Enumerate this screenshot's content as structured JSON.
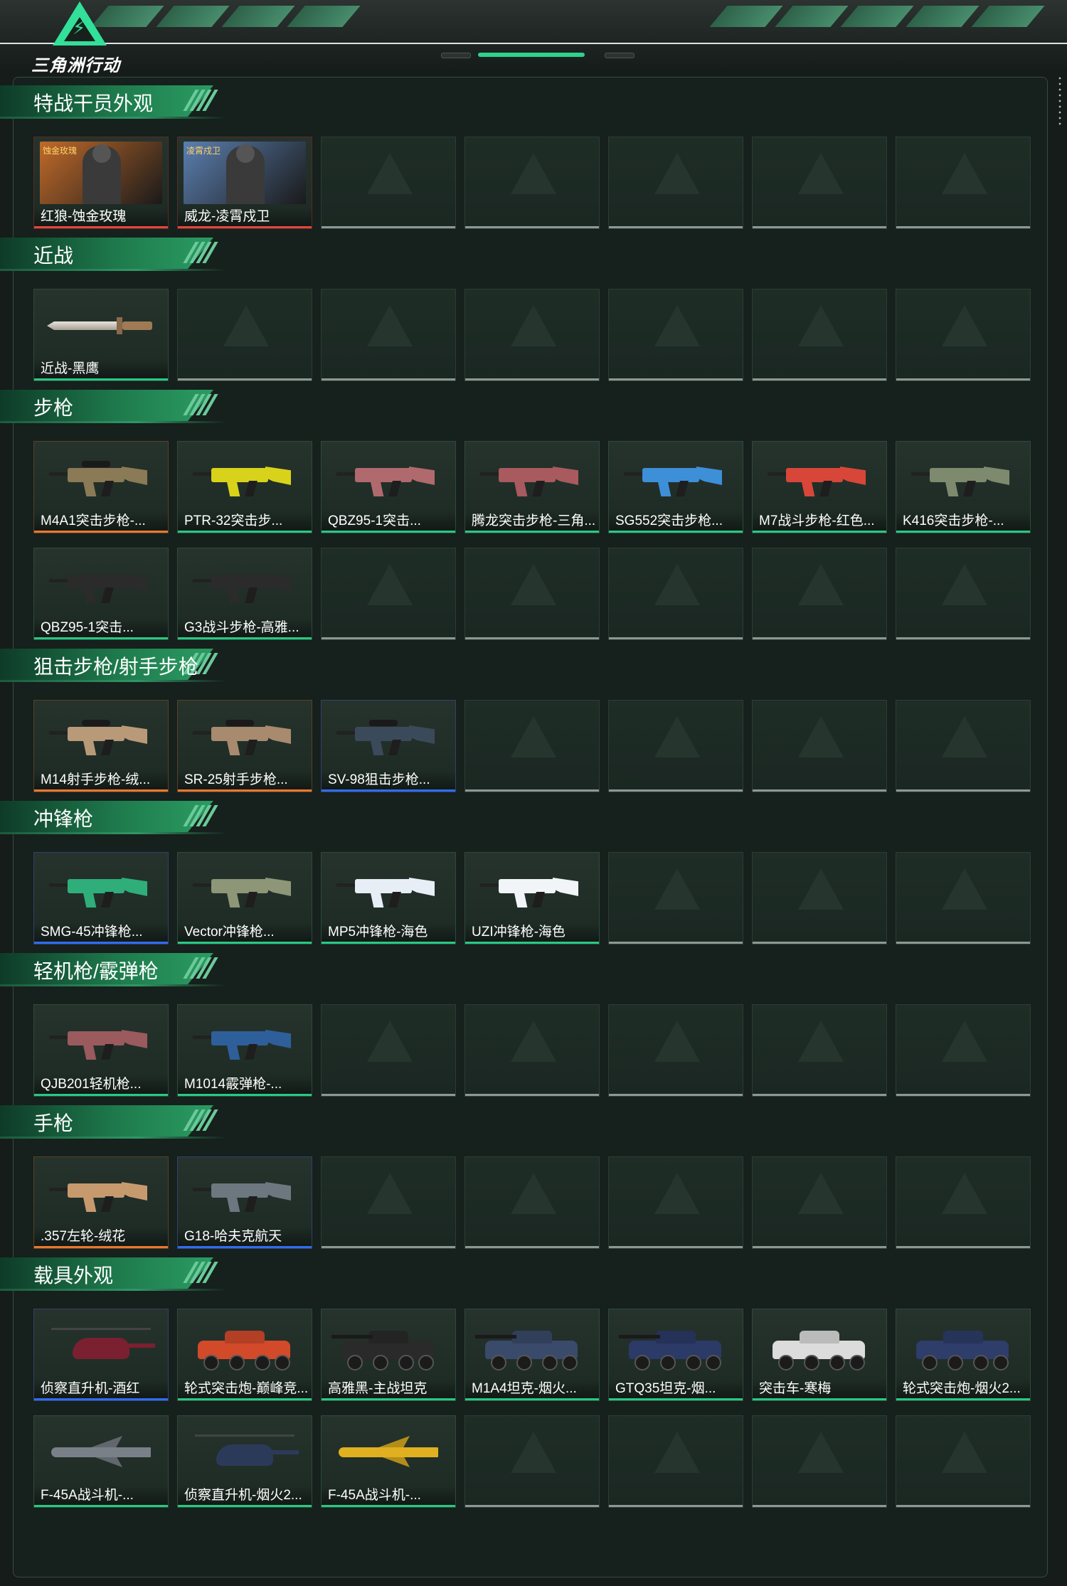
{
  "app": {
    "logo_text": "三角洲行动"
  },
  "sections": [
    {
      "title": "特战干员外观",
      "rows": 1,
      "items": [
        {
          "label": "红狼-蚀金玫瑰",
          "rarity": "red",
          "kind": "portrait",
          "color": "#c06a2a",
          "tag": "蚀金玫瑰"
        },
        {
          "label": "威龙-凌霄戍卫",
          "rarity": "red",
          "kind": "portrait",
          "color": "#5b7fb0",
          "tag": "凌霄戍卫"
        }
      ]
    },
    {
      "title": "近战",
      "rows": 1,
      "items": [
        {
          "label": "近战-黑鹰",
          "rarity": "green",
          "kind": "knife",
          "color": "#c9c2b6"
        }
      ]
    },
    {
      "title": "步枪",
      "rows": 2,
      "items": [
        {
          "label": "M4A1突击步枪-...",
          "rarity": "orange",
          "kind": "gun",
          "color": "#8a7a55",
          "scope": true
        },
        {
          "label": "PTR-32突击步...",
          "rarity": "green",
          "kind": "gun",
          "color": "#d8d21a"
        },
        {
          "label": "QBZ95-1突击...",
          "rarity": "green",
          "kind": "gun",
          "color": "#b06a6e"
        },
        {
          "label": "腾龙突击步枪-三角...",
          "rarity": "green",
          "kind": "gun",
          "color": "#a85a5e"
        },
        {
          "label": "SG552突击步枪...",
          "rarity": "green",
          "kind": "gun",
          "color": "#3d8fd8"
        },
        {
          "label": "M7战斗步枪-红色...",
          "rarity": "green",
          "kind": "gun",
          "color": "#d8463a"
        },
        {
          "label": "K416突击步枪-...",
          "rarity": "green",
          "kind": "gun",
          "color": "#7e8a6e"
        },
        {
          "label": "QBZ95-1突击...",
          "rarity": "green",
          "kind": "gun",
          "color": "#2b2b2b"
        },
        {
          "label": "G3战斗步枪-高雅...",
          "rarity": "green",
          "kind": "gun",
          "color": "#2b2b2b"
        }
      ]
    },
    {
      "title": "狙击步枪/射手步枪",
      "rows": 1,
      "items": [
        {
          "label": "M14射手步枪-绒...",
          "rarity": "orange",
          "kind": "gun",
          "color": "#b99a78",
          "scope": true
        },
        {
          "label": "SR-25射手步枪...",
          "rarity": "orange",
          "kind": "gun",
          "color": "#a88a6e",
          "scope": true
        },
        {
          "label": "SV-98狙击步枪...",
          "rarity": "blue",
          "kind": "gun",
          "color": "#3b4a5a",
          "scope": true
        }
      ]
    },
    {
      "title": "冲锋枪",
      "rows": 1,
      "items": [
        {
          "label": "SMG-45冲锋枪...",
          "rarity": "blue",
          "kind": "gun",
          "color": "#2fae7a"
        },
        {
          "label": "Vector冲锋枪...",
          "rarity": "green",
          "kind": "gun",
          "color": "#8d9676"
        },
        {
          "label": "MP5冲锋枪-海色",
          "rarity": "green",
          "kind": "gun",
          "color": "#e8eef5"
        },
        {
          "label": "UZI冲锋枪-海色",
          "rarity": "green",
          "kind": "gun",
          "color": "#f2f5f8"
        }
      ]
    },
    {
      "title": "轻机枪/霰弹枪",
      "rows": 1,
      "items": [
        {
          "label": "QJB201轻机枪...",
          "rarity": "green",
          "kind": "gun",
          "color": "#9a5a5e"
        },
        {
          "label": "M1014霰弹枪-...",
          "rarity": "green",
          "kind": "gun",
          "color": "#2f5f9a"
        }
      ]
    },
    {
      "title": "手枪",
      "rows": 1,
      "items": [
        {
          "label": ".357左轮-绒花",
          "rarity": "orange",
          "kind": "gun",
          "color": "#c79a6e"
        },
        {
          "label": "G18-哈夫克航天",
          "rarity": "blue",
          "kind": "gun",
          "color": "#6d7780"
        }
      ]
    },
    {
      "title": "载具外观",
      "rows": 2,
      "items": [
        {
          "label": "侦察直升机-酒红",
          "rarity": "blue",
          "kind": "heli",
          "color": "#7a2030"
        },
        {
          "label": "轮式突击炮-巅峰竞...",
          "rarity": "green",
          "kind": "car",
          "color": "#d24a2a"
        },
        {
          "label": "高雅黑-主战坦克",
          "rarity": "green",
          "kind": "tank",
          "color": "#2a2a2a"
        },
        {
          "label": "M1A4坦克-烟火...",
          "rarity": "green",
          "kind": "tank",
          "color": "#3a4a6a"
        },
        {
          "label": "GTQ35坦克-烟...",
          "rarity": "green",
          "kind": "tank",
          "color": "#2b3a66"
        },
        {
          "label": "突击车-寒梅",
          "rarity": "green",
          "kind": "car",
          "color": "#dcdcdc"
        },
        {
          "label": "轮式突击炮-烟火2...",
          "rarity": "green",
          "kind": "car",
          "color": "#2e3d6a"
        },
        {
          "label": "F-45A战斗机-...",
          "rarity": "green",
          "kind": "jet",
          "color": "#7a8088"
        },
        {
          "label": "侦察直升机-烟火2...",
          "rarity": "green",
          "kind": "heli",
          "color": "#2c3a5a"
        },
        {
          "label": "F-45A战斗机-...",
          "rarity": "green",
          "kind": "jet",
          "color": "#e0b020"
        }
      ]
    }
  ]
}
